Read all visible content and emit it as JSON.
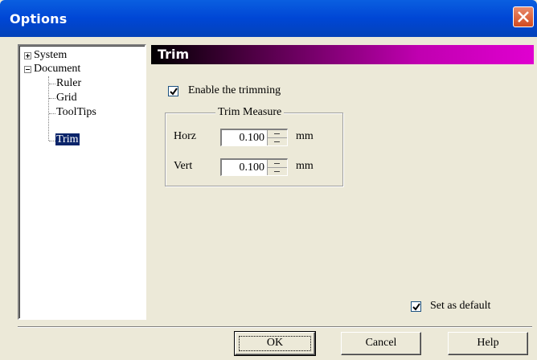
{
  "window": {
    "title": "Options"
  },
  "tree": {
    "items": [
      {
        "label": "System",
        "expander": "+"
      },
      {
        "label": "Document",
        "expander": "-"
      },
      {
        "label": "Ruler"
      },
      {
        "label": "Grid"
      },
      {
        "label": "ToolTips"
      },
      {
        "label": "Trim",
        "selected": true
      }
    ]
  },
  "panel": {
    "title": "Trim",
    "enable_trimming": {
      "label": "Enable the trimming",
      "checked": true
    },
    "trim_measure": {
      "title": "Trim Measure",
      "horz": {
        "label": "Horz",
        "value": "0.100",
        "unit": "mm"
      },
      "vert": {
        "label": "Vert",
        "value": "0.100",
        "unit": "mm"
      }
    },
    "set_as_default": {
      "label": "Set as default",
      "checked": true
    }
  },
  "buttons": {
    "ok": "OK",
    "cancel": "Cancel",
    "help": "Help"
  },
  "colors": {
    "titlebar": "#0046d5",
    "selected": "#0a246a",
    "header_gradient_end": "#e000d0"
  }
}
